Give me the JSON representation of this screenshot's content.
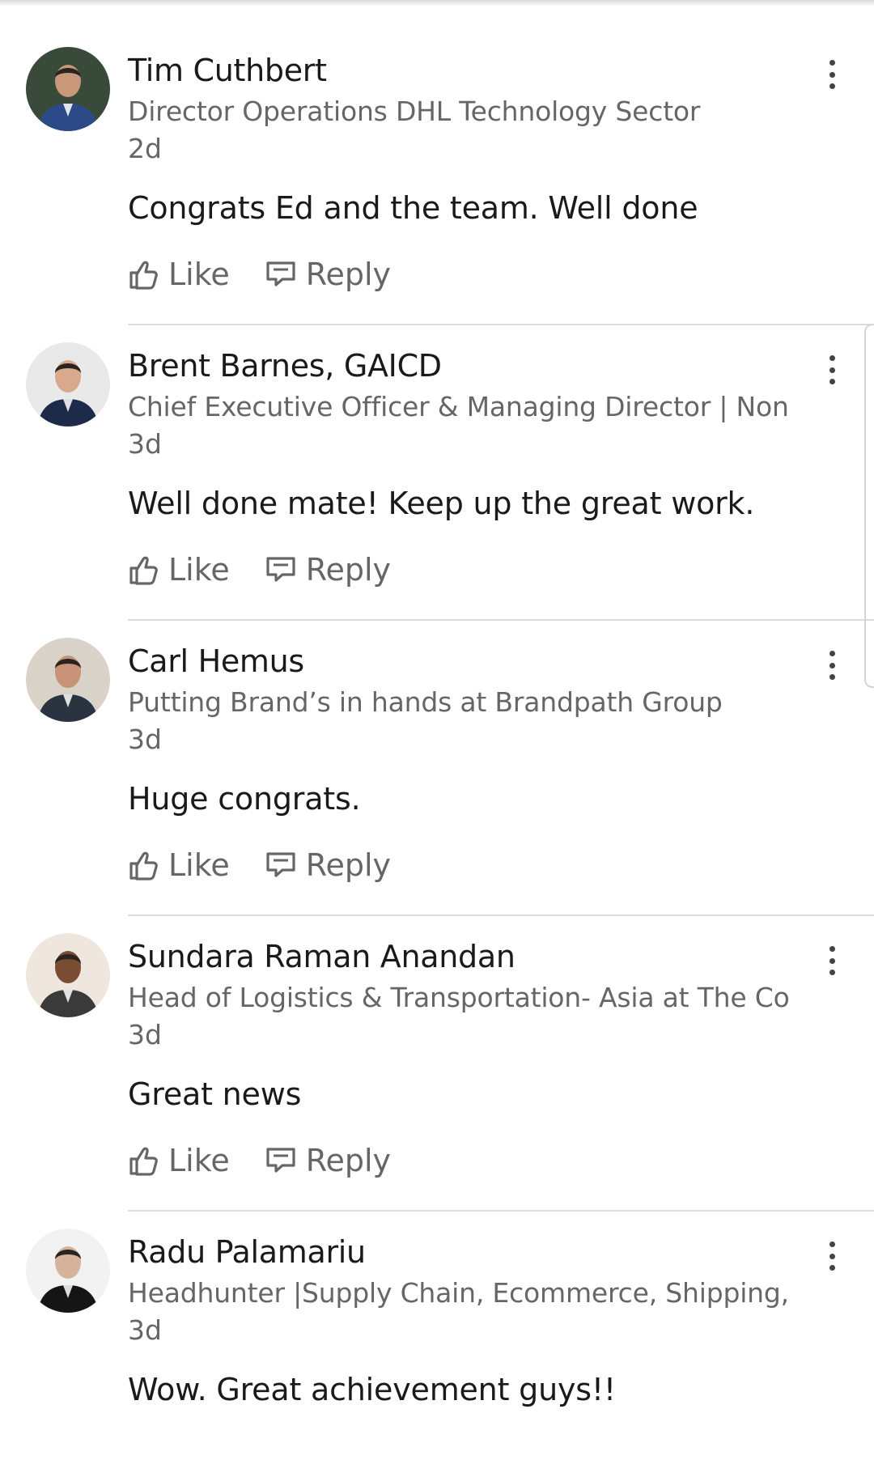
{
  "comments": [
    {
      "name": "Tim Cuthbert",
      "headline": "Director Operations DHL Technology Sector",
      "time": "2d",
      "text": "Congrats Ed and the team. Well done",
      "like_label": "Like",
      "reply_label": "Reply",
      "avatar": {
        "bg": "#3a4a3a",
        "skin": "#c99878",
        "shirt": "#2c4a88"
      }
    },
    {
      "name": "Brent Barnes, GAICD",
      "headline": "Chief Executive Officer & Managing Director | Non…",
      "time": "3d",
      "text": "Well done mate!  Keep up the great work.",
      "like_label": "Like",
      "reply_label": "Reply",
      "avatar": {
        "bg": "#e9e9e9",
        "skin": "#d9a98e",
        "shirt": "#1e2a4a"
      }
    },
    {
      "name": "Carl Hemus",
      "headline": "Putting Brand’s in hands at Brandpath Group",
      "time": "3d",
      "text": "Huge congrats.",
      "like_label": "Like",
      "reply_label": "Reply",
      "avatar": {
        "bg": "#d8d2c8",
        "skin": "#c79277",
        "shirt": "#2a3440"
      }
    },
    {
      "name": "Sundara Raman Anandan",
      "headline": "Head of Logistics & Transportation- Asia at The Co…",
      "time": "3d",
      "text": "Great news",
      "like_label": "Like",
      "reply_label": "Reply",
      "avatar": {
        "bg": "#efe6dd",
        "skin": "#7a4c32",
        "shirt": "#3a3a3a"
      }
    },
    {
      "name": "Radu Palamariu",
      "headline": "Headhunter |Supply Chain, Ecommerce, Shipping,…",
      "time": "3d",
      "text": "Wow. Great achievement guys!!",
      "like_label": "Like",
      "reply_label": "Reply",
      "avatar": {
        "bg": "#f2f2f2",
        "skin": "#d8b39c",
        "shirt": "#151515"
      }
    }
  ],
  "icons": {
    "more": "more-vertical-icon",
    "like": "thumbs-up-icon",
    "reply": "reply-speech-bubble-icon"
  },
  "colors": {
    "text_primary": "#1a1a1a",
    "text_secondary": "#666666",
    "divider": "#dcdcdc",
    "background": "#ffffff"
  }
}
